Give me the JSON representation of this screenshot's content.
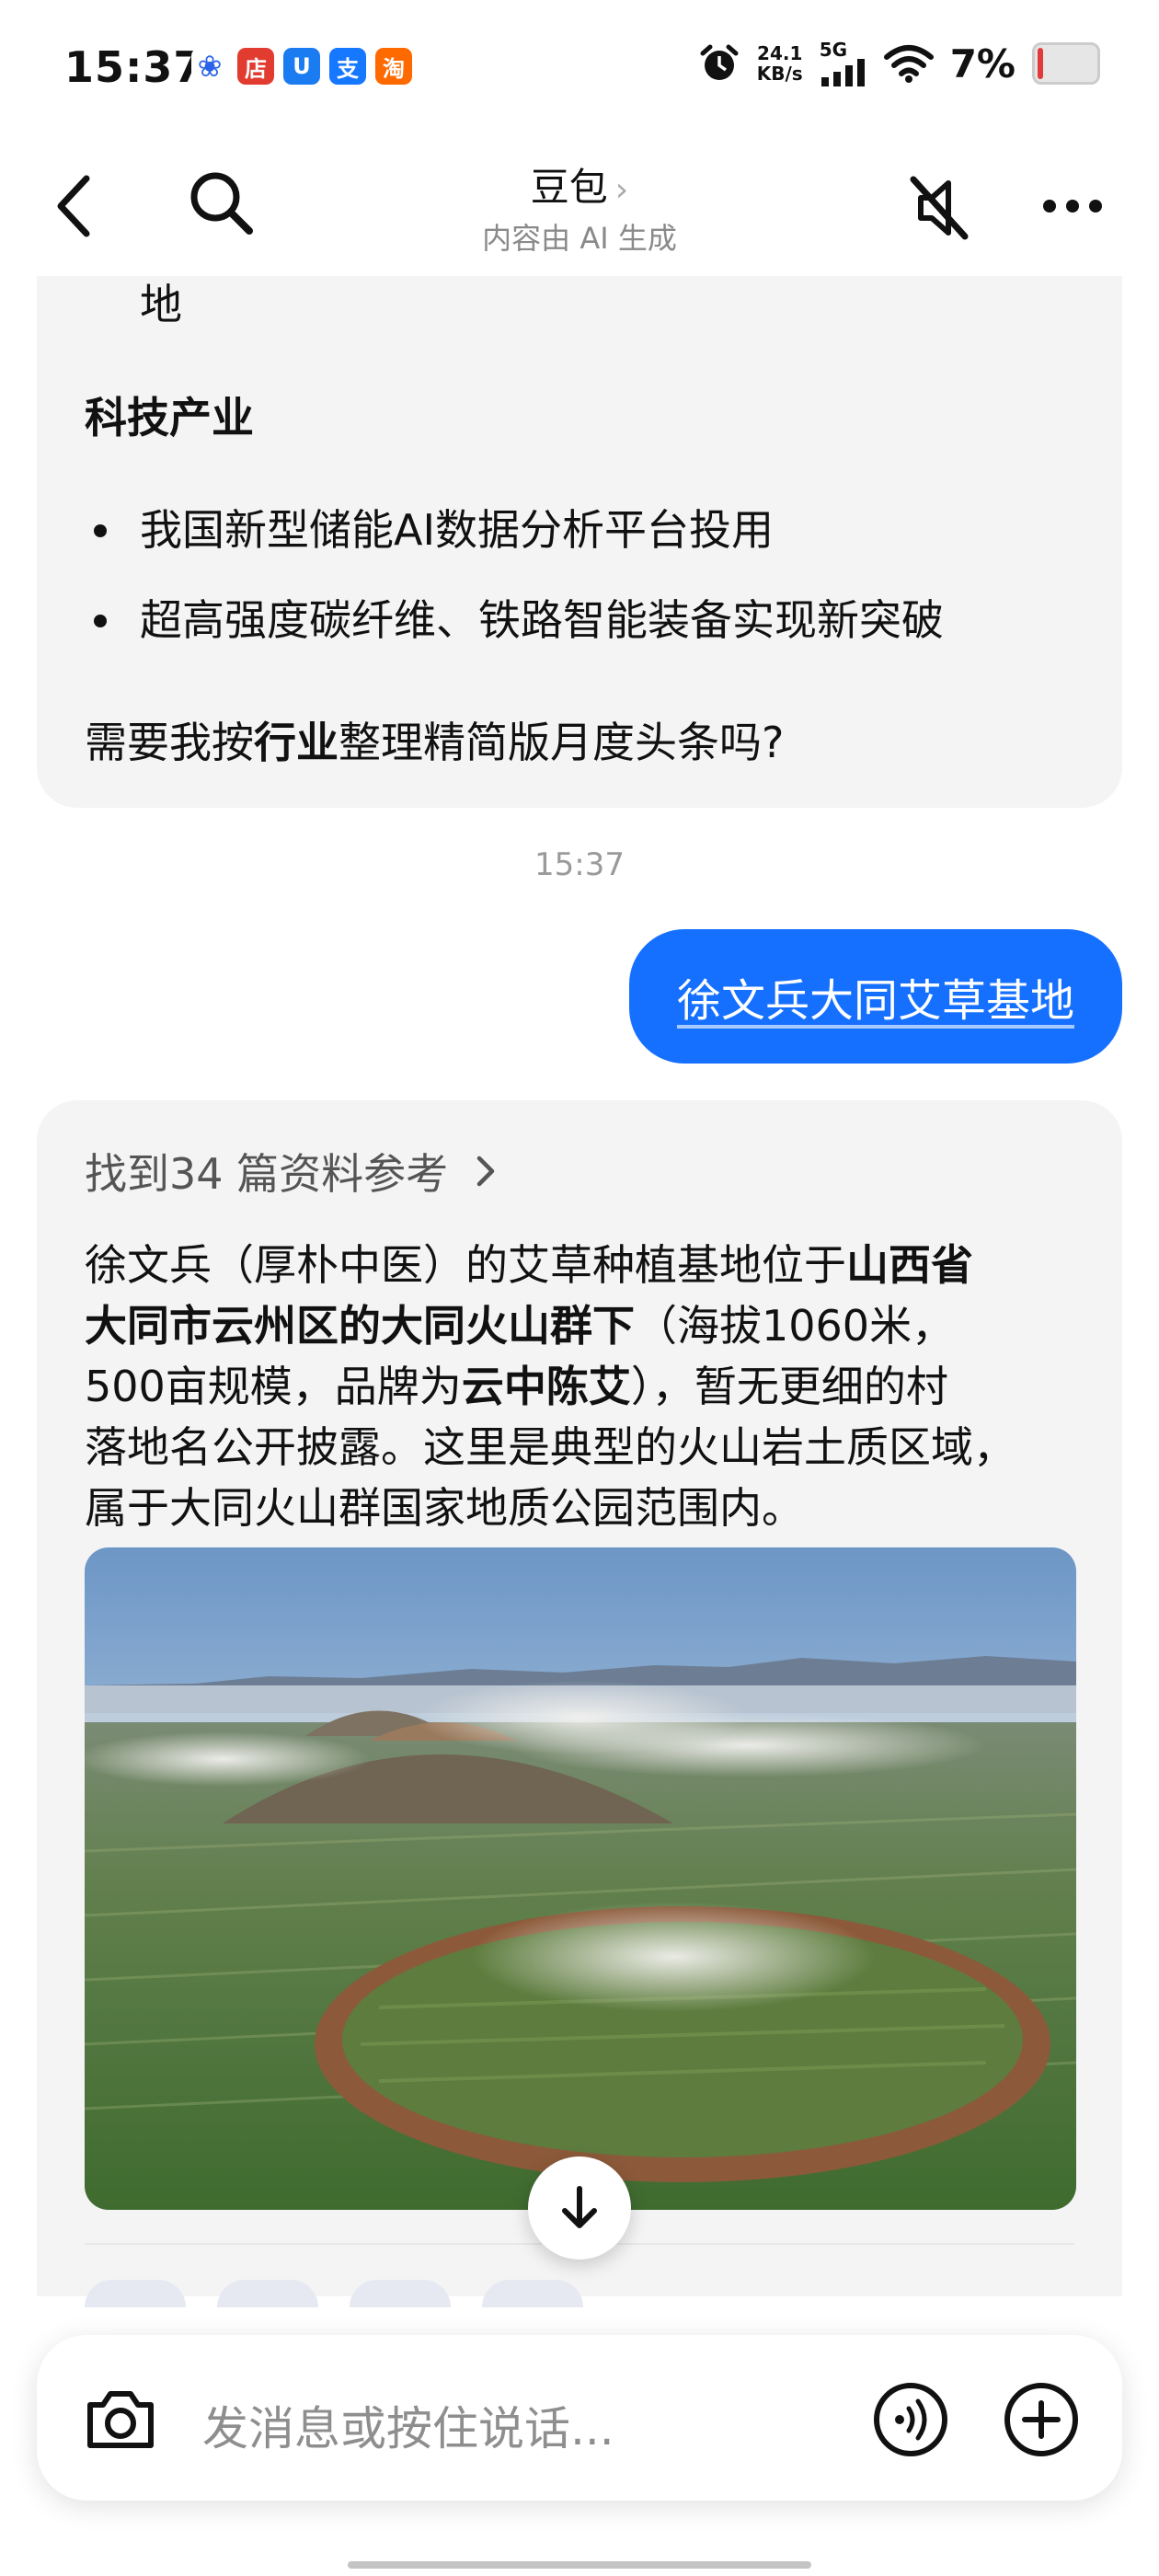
{
  "status_bar": {
    "time": "15:37",
    "app_icons": [
      {
        "name": "baidu-paw-icon",
        "glyph": "🐾",
        "color": "#2b63e8"
      },
      {
        "name": "shop-icon",
        "glyph": "店",
        "color": "#e23b2f"
      },
      {
        "name": "u-app-icon",
        "glyph": "U",
        "color": "#1a7cf0"
      },
      {
        "name": "alipay-icon",
        "glyph": "支",
        "color": "#1677ff"
      },
      {
        "name": "taobao-icon",
        "glyph": "淘",
        "color": "#ff6a00"
      }
    ],
    "net_speed_value": "24.1",
    "net_speed_unit": "KB/s",
    "network": "5G",
    "battery": "7%"
  },
  "nav": {
    "title": "豆包",
    "title_chevron": "›",
    "subtitle": "内容由 AI 生成"
  },
  "prev_message": {
    "cut_text": "地",
    "section_title": "科技产业",
    "bullets": [
      "我国新型储能AI数据分析平台投用",
      "超高强度碳纤维、铁路智能装备实现新突破"
    ],
    "question_pre": "需要我按",
    "question_bold": "行业",
    "question_post": "整理精简版月度头条吗?"
  },
  "timestamp": "15:37",
  "user_message": "徐文兵大同艾草基地",
  "reply": {
    "references": "找到34 篇资料参考",
    "p1": "徐文兵（厚朴中医）的艾草种植基地位于",
    "b1": "山西省",
    "b2": "大同市云州区的大同火山群下",
    "p2": "（海拔1060米，",
    "p3": "500亩规模，品牌为",
    "b3": "云中陈艾",
    "p4": "），暂无更细的村",
    "p5": "落地名公开披露。这里是典型的火山岩土质区域，",
    "p6": "属于大同火山群国家地质公园范围内。"
  },
  "input": {
    "placeholder": "发消息或按住说话..."
  },
  "colors": {
    "accent": "#1670ff",
    "card_bg": "#f4f4f5"
  }
}
